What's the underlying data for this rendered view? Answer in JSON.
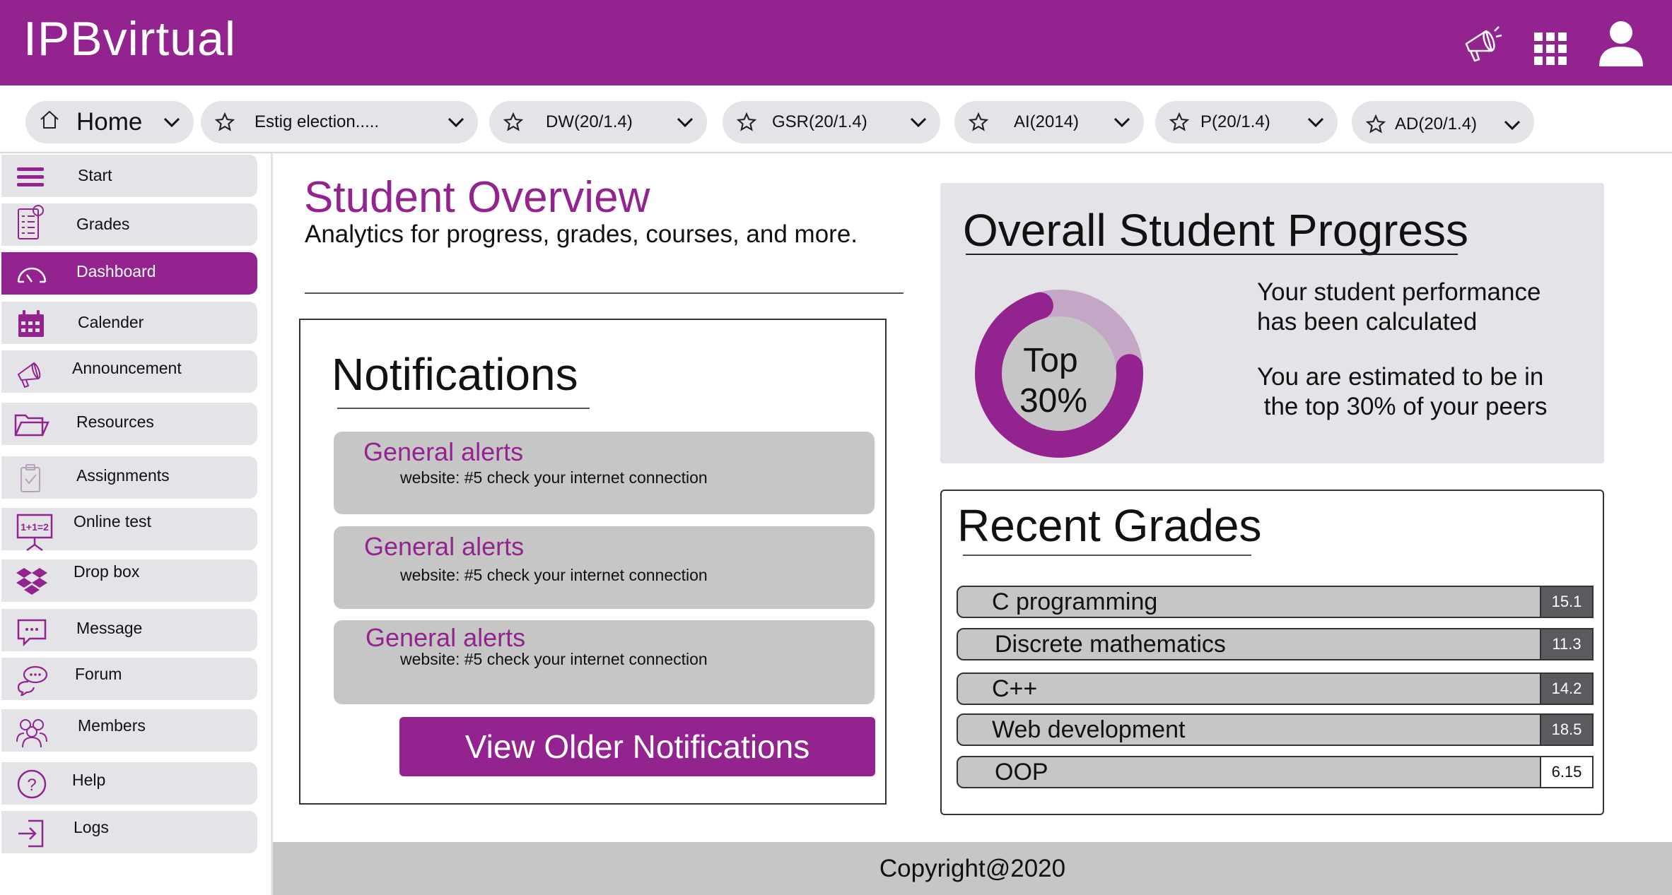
{
  "app": {
    "title": "IPBvirtual",
    "brand_color": "#93248f"
  },
  "header": {
    "icons": [
      "megaphone-icon",
      "apps-grid-icon",
      "user-icon"
    ]
  },
  "tabs": [
    {
      "label": "Home",
      "icon": "home-icon"
    },
    {
      "label": "Estig election.....",
      "icon": "star-icon"
    },
    {
      "label": "DW(20/1.4)",
      "icon": "star-icon"
    },
    {
      "label": "GSR(20/1.4)",
      "icon": "star-icon"
    },
    {
      "label": "AI(2014)",
      "icon": "star-icon"
    },
    {
      "label": "P(20/1.4)",
      "icon": "star-icon"
    },
    {
      "label": "AD(20/1.4)",
      "icon": "star-icon"
    }
  ],
  "sidebar": {
    "active": "Dashboard",
    "items": [
      {
        "label": "Start",
        "icon": "menu-icon"
      },
      {
        "label": "Grades",
        "icon": "grades-icon"
      },
      {
        "label": "Dashboard",
        "icon": "speedometer-icon"
      },
      {
        "label": "Calender",
        "icon": "calendar-icon"
      },
      {
        "label": "Announcement",
        "icon": "megaphone-icon"
      },
      {
        "label": "Resources",
        "icon": "folder-icon"
      },
      {
        "label": "Assignments",
        "icon": "clipboard-icon"
      },
      {
        "label": "Online test",
        "icon": "whiteboard-icon"
      },
      {
        "label": "Drop box",
        "icon": "dropbox-icon"
      },
      {
        "label": "Message",
        "icon": "message-icon"
      },
      {
        "label": "Forum",
        "icon": "forum-icon"
      },
      {
        "label": "Members",
        "icon": "members-icon"
      },
      {
        "label": "Help",
        "icon": "help-icon"
      },
      {
        "label": "Logs",
        "icon": "logout-icon"
      }
    ]
  },
  "overview": {
    "title": "Student Overview",
    "subtitle": "Analytics for progress, grades, courses, and more."
  },
  "notifications": {
    "title": "Notifications",
    "items": [
      {
        "title": "General alerts",
        "text": "website:  #5 check your internet connection"
      },
      {
        "title": "General alerts",
        "text": "website:  #5 check your internet connection"
      },
      {
        "title": "General alerts",
        "text": "website:  #5 check your internet connection"
      }
    ],
    "button_label": "View Older Notifications"
  },
  "progress": {
    "title": "Overall Student Progress",
    "donut_line1": "Top",
    "donut_line2": "30%",
    "fraction_filled": 0.72,
    "line1": "Your student performance",
    "line2": "has been calculated",
    "line3": "You are estimated to be in",
    "line4": " the top 30% of your peers"
  },
  "grades": {
    "title": "Recent Grades",
    "items": [
      {
        "course": "C programming",
        "grade": "15.1"
      },
      {
        "course": "Discrete mathematics",
        "grade": "11.3"
      },
      {
        "course": "C++",
        "grade": "14.2"
      },
      {
        "course": "Web development",
        "grade": "18.5"
      },
      {
        "course": "OOP",
        "grade": "6.15"
      }
    ]
  },
  "footer": {
    "text": "Copyright@2020"
  }
}
